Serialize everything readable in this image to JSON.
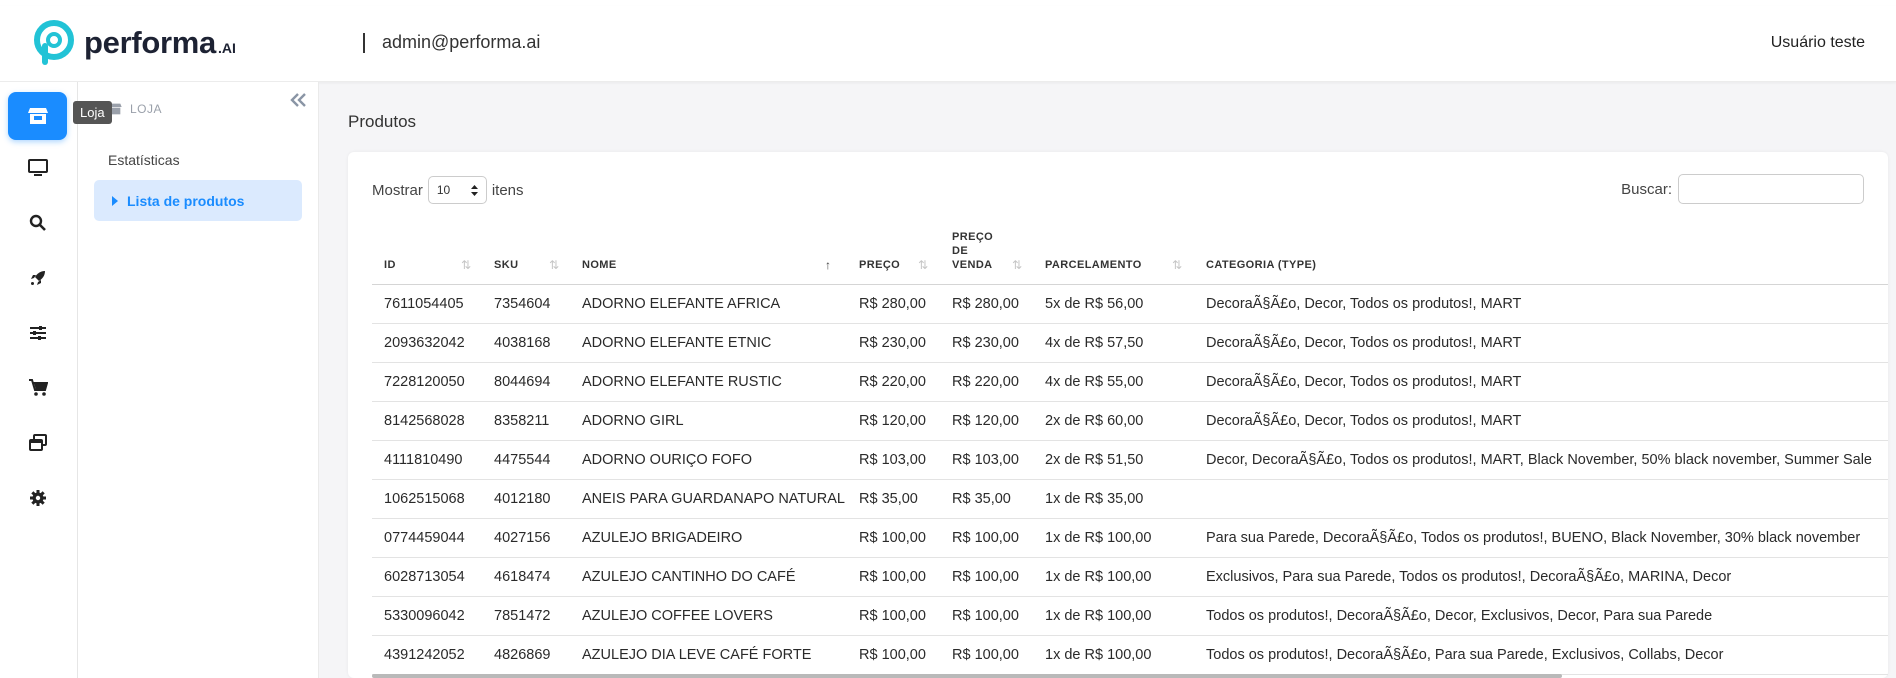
{
  "header": {
    "brand": "performa",
    "brand_suffix": ".AI",
    "email": "admin@performa.ai",
    "user": "Usuário teste"
  },
  "iconbar": {
    "items": [
      {
        "icon": "store-icon",
        "active": true
      },
      {
        "icon": "monitor-icon"
      },
      {
        "icon": "search-icon"
      },
      {
        "icon": "rocket-icon"
      },
      {
        "icon": "sliders-icon"
      },
      {
        "icon": "cart-icon"
      },
      {
        "icon": "windows-icon"
      },
      {
        "icon": "gear-icon"
      }
    ],
    "tooltip": "Loja"
  },
  "sidebar": {
    "section": "LOJA",
    "items": [
      {
        "label": "Estatísticas"
      },
      {
        "label": "Lista de produtos",
        "active": true
      }
    ]
  },
  "main": {
    "title": "Produtos",
    "show_label": "Mostrar",
    "show_value": "10",
    "items_label": "itens",
    "search_label": "Buscar:",
    "search_value": ""
  },
  "table": {
    "columns": [
      "ID",
      "SKU",
      "NOME",
      "PREÇO",
      "PREÇO DE VENDA",
      "PARCELAMENTO",
      "CATEGORIA (TYPE)"
    ],
    "rows": [
      [
        "7611054405",
        "7354604",
        "ADORNO ELEFANTE AFRICA",
        "R$ 280,00",
        "R$ 280,00",
        "5x de R$ 56,00",
        "DecoraÃ§Ã£o, Decor, Todos os produtos!, MART"
      ],
      [
        "2093632042",
        "4038168",
        "ADORNO ELEFANTE ETNIC",
        "R$ 230,00",
        "R$ 230,00",
        "4x de R$ 57,50",
        "DecoraÃ§Ã£o, Decor, Todos os produtos!, MART"
      ],
      [
        "7228120050",
        "8044694",
        "ADORNO ELEFANTE RUSTIC",
        "R$ 220,00",
        "R$ 220,00",
        "4x de R$ 55,00",
        "DecoraÃ§Ã£o, Decor, Todos os produtos!, MART"
      ],
      [
        "8142568028",
        "8358211",
        "ADORNO GIRL",
        "R$ 120,00",
        "R$ 120,00",
        "2x de R$ 60,00",
        "DecoraÃ§Ã£o, Decor, Todos os produtos!, MART"
      ],
      [
        "4111810490",
        "4475544",
        "ADORNO OURIÇO FOFO",
        "R$ 103,00",
        "R$ 103,00",
        "2x de R$ 51,50",
        "Decor, DecoraÃ§Ã£o, Todos os produtos!, MART, Black November, 50% black november, Summer Sale"
      ],
      [
        "1062515068",
        "4012180",
        "ANEIS PARA GUARDANAPO NATURAL",
        "R$ 35,00",
        "R$ 35,00",
        "1x de R$ 35,00",
        ""
      ],
      [
        "0774459044",
        "4027156",
        "AZULEJO BRIGADEIRO",
        "R$ 100,00",
        "R$ 100,00",
        "1x de R$ 100,00",
        "Para sua Parede, DecoraÃ§Ã£o, Todos os produtos!, BUENO, Black November, 30% black november"
      ],
      [
        "6028713054",
        "4618474",
        "AZULEJO CANTINHO DO CAFÉ",
        "R$ 100,00",
        "R$ 100,00",
        "1x de R$ 100,00",
        "Exclusivos, Para sua Parede, Todos os produtos!, DecoraÃ§Ã£o, MARINA, Decor"
      ],
      [
        "5330096042",
        "7851472",
        "AZULEJO COFFEE LOVERS",
        "R$ 100,00",
        "R$ 100,00",
        "1x de R$ 100,00",
        "Todos os produtos!, DecoraÃ§Ã£o, Decor, Exclusivos, Decor, Para sua Parede"
      ],
      [
        "4391242052",
        "4826869",
        "AZULEJO DIA LEVE CAFÉ FORTE",
        "R$ 100,00",
        "R$ 100,00",
        "1x de R$ 100,00",
        "Todos os produtos!, DecoraÃ§Ã£o, Para sua Parede, Exclusivos, Collabs, Decor"
      ]
    ]
  },
  "colors": {
    "accent": "#1a8cff",
    "active_bg": "#dbeafe",
    "brand_teal": "#22c3d6"
  }
}
